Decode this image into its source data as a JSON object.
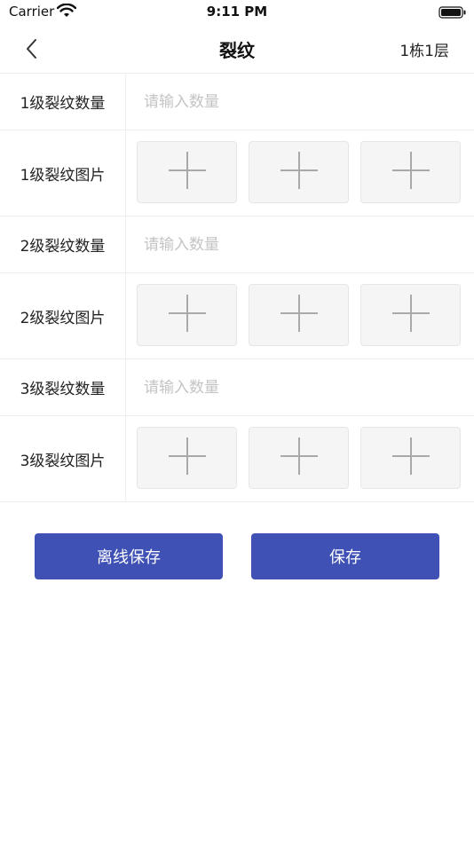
{
  "status_bar": {
    "carrier": "Carrier",
    "time": "9:11 PM",
    "wifi_icon": "wifi-icon",
    "battery_icon": "battery-icon"
  },
  "nav": {
    "back_icon": "chevron-left-icon",
    "title": "裂纹",
    "right_label": "1栋1层"
  },
  "form": {
    "rows": [
      {
        "type": "count",
        "label": "1级裂纹数量",
        "value": "",
        "placeholder": "请输入数量"
      },
      {
        "type": "images",
        "label": "1级裂纹图片",
        "slots": 3,
        "slot_icon": "plus-icon"
      },
      {
        "type": "count",
        "label": "2级裂纹数量",
        "value": "",
        "placeholder": "请输入数量"
      },
      {
        "type": "images",
        "label": "2级裂纹图片",
        "slots": 3,
        "slot_icon": "plus-icon"
      },
      {
        "type": "count",
        "label": "3级裂纹数量",
        "value": "",
        "placeholder": "请输入数量"
      },
      {
        "type": "images",
        "label": "3级裂纹图片",
        "slots": 3,
        "slot_icon": "plus-icon"
      }
    ]
  },
  "actions": {
    "offline_save_label": "离线保存",
    "save_label": "保存"
  },
  "colors": {
    "primary": "#3f51b5",
    "placeholder": "#c4c4c4",
    "slot_background": "#f5f5f5",
    "divider": "#eeeeee"
  }
}
